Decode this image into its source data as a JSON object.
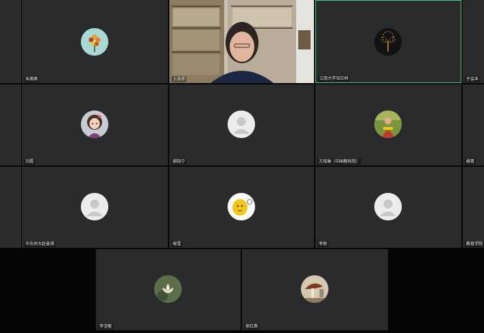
{
  "participants": [
    {
      "name": "",
      "avatar": "none"
    },
    {
      "name": "朱茜茜",
      "avatar": "flower-bouquet-avatar"
    },
    {
      "name": "卜玉华",
      "avatar": "video-feed"
    },
    {
      "name": "江南大学伍红林",
      "avatar": "dark-tree-avatar",
      "active": true
    },
    {
      "name": "于会丰",
      "avatar": "none"
    },
    {
      "name": "",
      "avatar": "none"
    },
    {
      "name": "刘霞",
      "avatar": "cartoon-girl-avatar"
    },
    {
      "name": "郝晓宁",
      "avatar": "default-person-avatar"
    },
    {
      "name": "方铭琳（中国教科院）",
      "avatar": "photo-person-avatar"
    },
    {
      "name": "柳青",
      "avatar": "none"
    },
    {
      "name": "",
      "avatar": "none"
    },
    {
      "name": "华东师大赵曼琪",
      "avatar": "default-person-avatar"
    },
    {
      "name": "喻雪",
      "avatar": "yellow-cartoon-avatar"
    },
    {
      "name": "李艳",
      "avatar": "default-person-avatar"
    },
    {
      "name": "教育学院",
      "avatar": "none"
    },
    {
      "name": "李宝敏",
      "avatar": "lotus-flower-avatar"
    },
    {
      "name": "徐红燕",
      "avatar": "mushroom-photo-avatar"
    }
  ],
  "colors": {
    "tile_bg": "#2a2b2d",
    "active_border": "#3fd18a",
    "page_bg": "#050505"
  }
}
